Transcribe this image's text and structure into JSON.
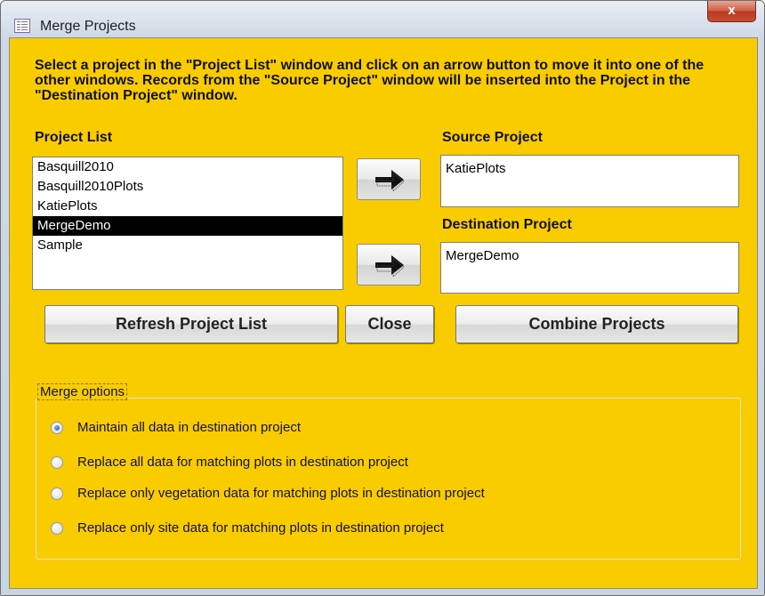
{
  "window": {
    "title": "Merge Projects",
    "close_glyph": "x"
  },
  "instructions": "Select a project in the \"Project List\" window and click on an arrow button to move it into one of the other windows. Records from the \"Source Project\" window will be inserted into the Project in the \"Destination Project\" window.",
  "project_list": {
    "label": "Project List",
    "items": [
      "Basquill2010",
      "Basquill2010Plots",
      "KatiePlots",
      "MergeDemo",
      "Sample"
    ],
    "selected": "MergeDemo"
  },
  "source": {
    "label": "Source Project",
    "value": "KatiePlots"
  },
  "destination": {
    "label": "Destination Project",
    "value": "MergeDemo"
  },
  "buttons": {
    "refresh": "Refresh Project List",
    "close": "Close",
    "combine": "Combine Projects"
  },
  "icons": {
    "app": "form-icon",
    "arrow": "right-arrow-icon"
  },
  "merge_options": {
    "label": "Merge options",
    "options": [
      {
        "label": "Maintain all data in destination project",
        "checked": true
      },
      {
        "label": "Replace all data for matching plots in destination project",
        "checked": false
      },
      {
        "label": "Replace only vegetation data for matching plots in destination project",
        "checked": false
      },
      {
        "label": "Replace only site data for matching plots in destination project",
        "checked": false
      }
    ]
  },
  "colors": {
    "form_background": "#f9cc00",
    "selection": "#000000"
  }
}
